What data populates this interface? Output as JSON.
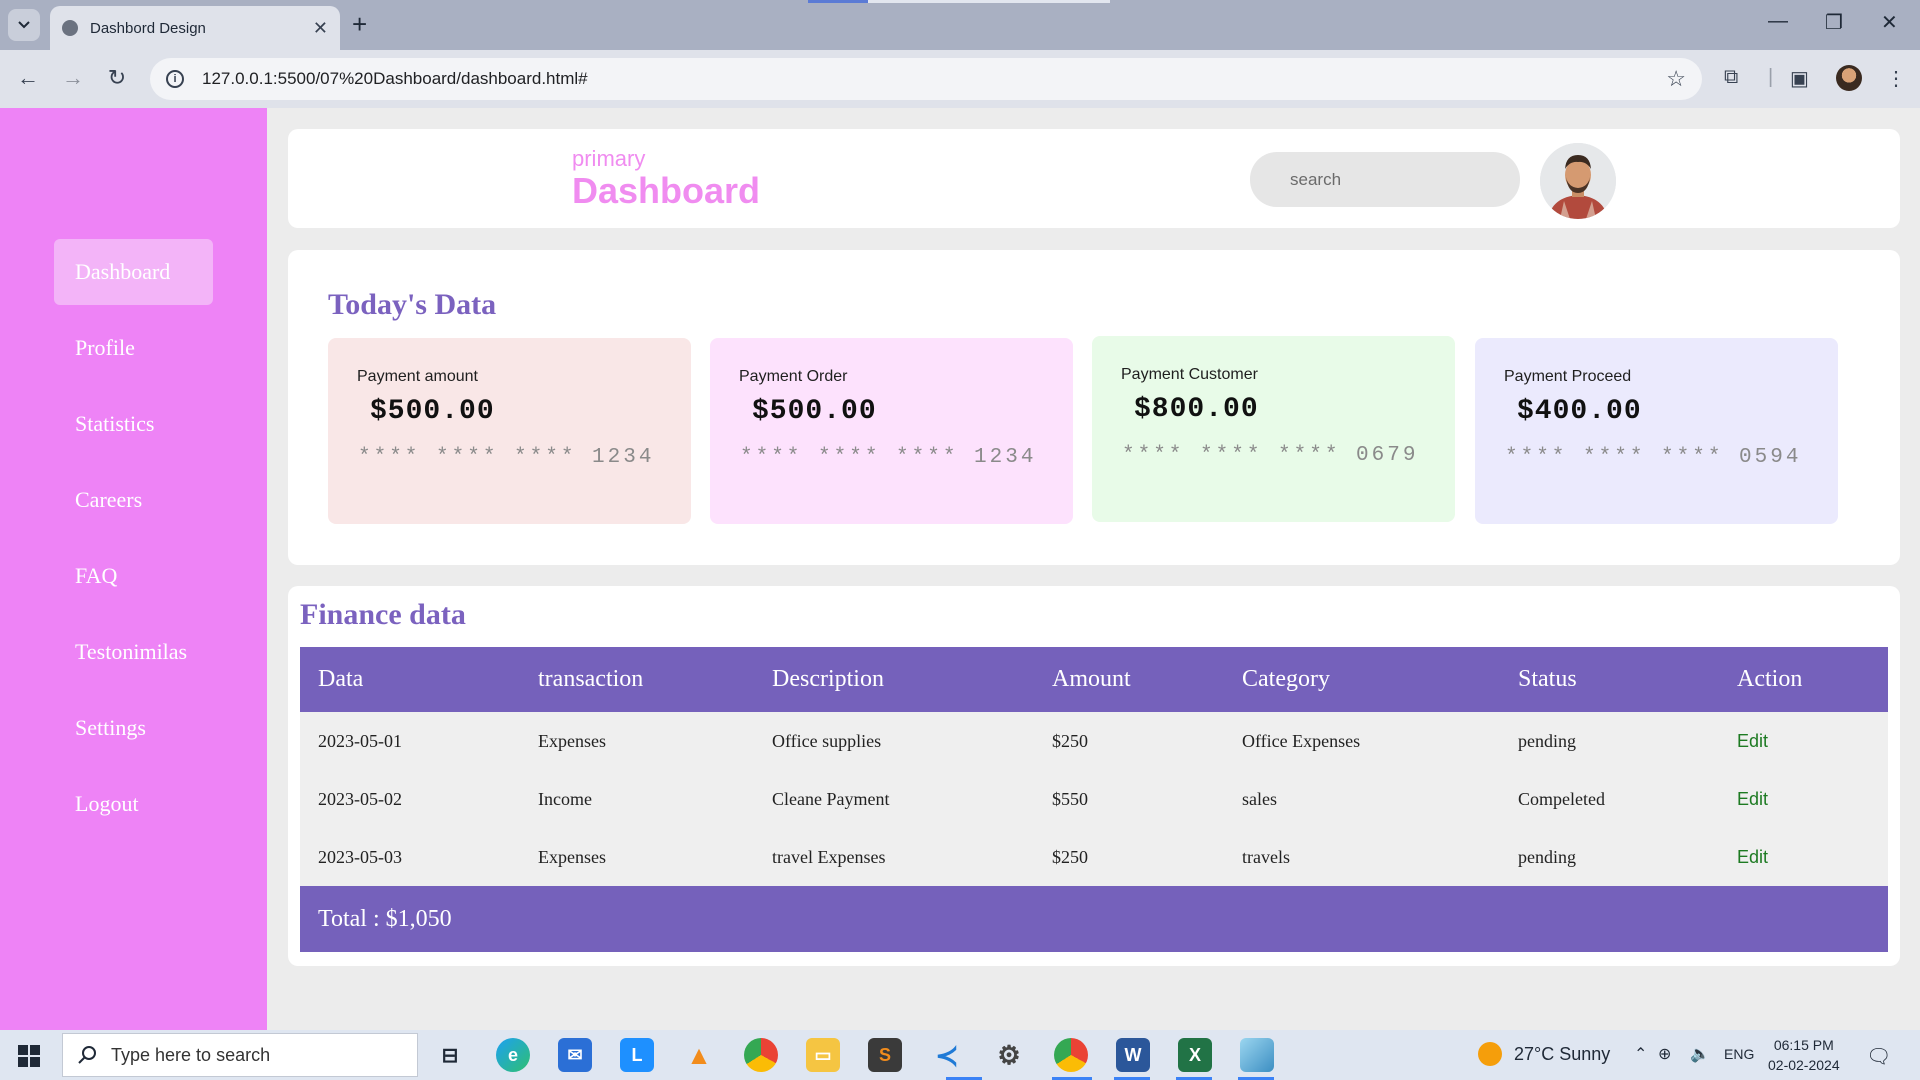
{
  "browser": {
    "tab_title": "Dashbord Design",
    "url": "127.0.0.1:5500/07%20Dashboard/dashboard.html#"
  },
  "sidebar": {
    "items": [
      {
        "label": "Dashboard",
        "active": true
      },
      {
        "label": "Profile"
      },
      {
        "label": "Statistics"
      },
      {
        "label": "Careers"
      },
      {
        "label": "FAQ"
      },
      {
        "label": "Testonimilas"
      },
      {
        "label": "Settings"
      },
      {
        "label": "Logout"
      }
    ]
  },
  "header": {
    "subtitle": "primary",
    "title": "Dashboard",
    "search_placeholder": "search"
  },
  "today": {
    "title": "Today's Data",
    "cards": [
      {
        "label": "Payment amount",
        "amount": "$500.00",
        "number": "**** **** **** 1234",
        "color": "#f9e7e7"
      },
      {
        "label": "Payment Order",
        "amount": "$500.00",
        "number": "**** **** **** 1234",
        "color": "#fde2fd"
      },
      {
        "label": "Payment Customer",
        "amount": "$800.00",
        "number": "**** **** **** 0679",
        "color": "#e8fbe8"
      },
      {
        "label": "Payment Proceed",
        "amount": "$400.00",
        "number": "**** **** **** 0594",
        "color": "#ebeafd"
      }
    ]
  },
  "finance": {
    "title": "Finance data",
    "columns": [
      "Data",
      "transaction",
      "Description",
      "Amount",
      "Category",
      "Status",
      "Action"
    ],
    "rows": [
      [
        "2023-05-01",
        "Expenses",
        "Office supplies",
        "$250",
        "Office Expenses",
        "pending",
        "Edit"
      ],
      [
        "2023-05-02",
        "Income",
        "Cleane Payment",
        "$550",
        "sales",
        "Compeleted",
        "Edit"
      ],
      [
        "2023-05-03",
        "Expenses",
        "travel Expenses",
        "$250",
        "travels",
        "pending",
        "Edit"
      ]
    ],
    "total": "Total : $1,050"
  },
  "taskbar": {
    "search_placeholder": "Type here to search",
    "weather": "27°C  Sunny",
    "language": "ENG",
    "time": "06:15 PM",
    "date": "02-02-2024"
  },
  "colors": {
    "sidebar": "#ee83f6",
    "accent": "#7561bb",
    "title_pink": "#f08cf0"
  }
}
